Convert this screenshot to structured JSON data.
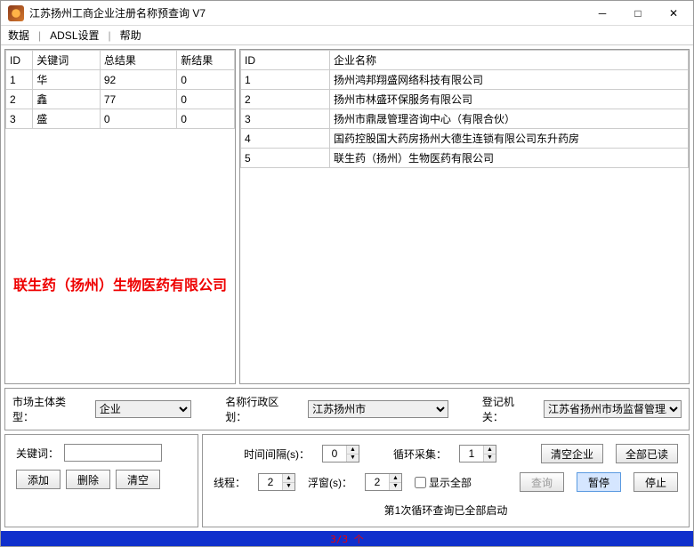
{
  "window": {
    "title": "江苏扬州工商企业注册名称预查询 V7"
  },
  "menu": {
    "data": "数据",
    "adsl": "ADSL设置",
    "help": "帮助"
  },
  "left_table": {
    "headers": {
      "id": "ID",
      "kw": "关键词",
      "total": "总结果",
      "new": "新结果"
    },
    "rows": [
      {
        "id": "1",
        "kw": "华",
        "total": "92",
        "new": "0"
      },
      {
        "id": "2",
        "kw": "鑫",
        "total": "77",
        "new": "0"
      },
      {
        "id": "3",
        "kw": "盛",
        "total": "0",
        "new": "0"
      }
    ]
  },
  "right_table": {
    "headers": {
      "id": "ID",
      "name": "企业名称"
    },
    "rows": [
      {
        "id": "1",
        "name": "扬州鸿邦翔盛网络科技有限公司"
      },
      {
        "id": "2",
        "name": "扬州市林盛环保服务有限公司"
      },
      {
        "id": "3",
        "name": "扬州市鼎晟管理咨询中心（有限合伙）"
      },
      {
        "id": "4",
        "name": "国药控股国大药房扬州大德生连锁有限公司东升药房"
      },
      {
        "id": "5",
        "name": "联生药（扬州）生物医药有限公司"
      }
    ]
  },
  "highlight": "联生药（扬州）生物医药有限公司",
  "filters": {
    "type_label": "市场主体类型：",
    "type_value": "企业",
    "region_label": "名称行政区划：",
    "region_value": "江苏扬州市",
    "registry_label": "登记机关：",
    "registry_value": "江苏省扬州市场监督管理局"
  },
  "keyword_box": {
    "label": "关键词：",
    "add": "添加",
    "del": "删除",
    "clear": "清空"
  },
  "controls": {
    "interval_label": "时间间隔(s)：",
    "interval_value": "0",
    "loop_label": "循环采集：",
    "loop_value": "1",
    "clear_ent": "清空企业",
    "all_read": "全部已读",
    "thread_label": "线程：",
    "thread_value": "2",
    "float_label": "浮窗(s)：",
    "float_value": "2",
    "show_all": "显示全部",
    "query": "查询",
    "pause": "暂停",
    "stop": "停止",
    "status": "第1次循环查询已全部启动"
  },
  "footer": "3/3 个"
}
